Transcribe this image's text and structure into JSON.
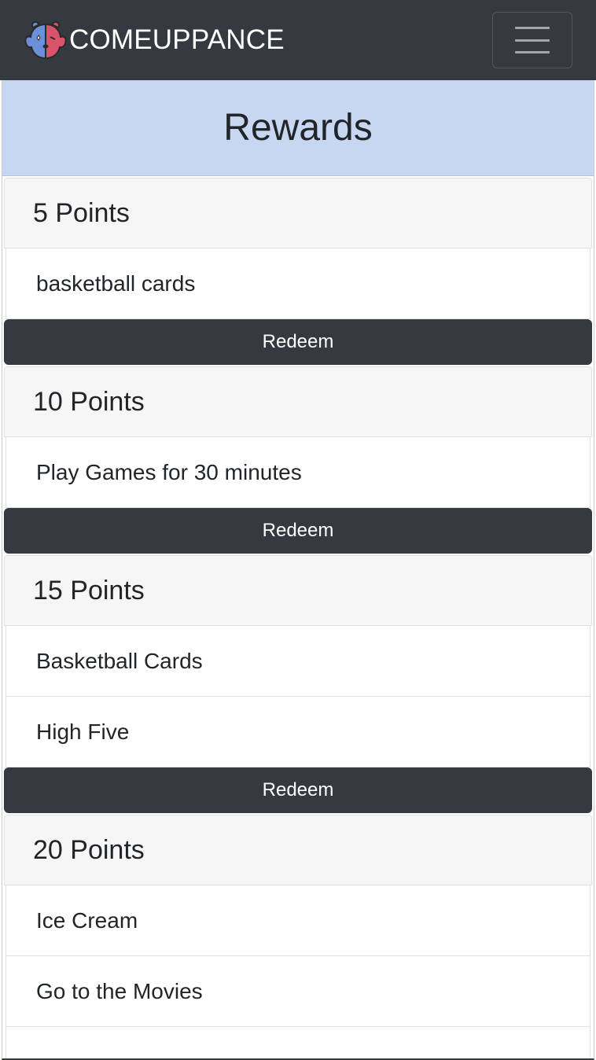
{
  "navbar": {
    "brand": "COMEUPPANCE",
    "logo_icon": "dog-face-logo-icon",
    "menu_icon": "hamburger-menu-icon"
  },
  "page": {
    "title": "Rewards"
  },
  "tiers": [
    {
      "points_label": "5 Points",
      "items": [
        "basketball cards"
      ],
      "redeem_label": "Redeem"
    },
    {
      "points_label": "10 Points",
      "items": [
        "Play Games for 30 minutes"
      ],
      "redeem_label": "Redeem"
    },
    {
      "points_label": "15 Points",
      "items": [
        "Basketball Cards",
        "High Five"
      ],
      "redeem_label": "Redeem"
    },
    {
      "points_label": "20 Points",
      "items": [
        "Ice Cream",
        "Go to the Movies"
      ]
    }
  ],
  "colors": {
    "navbar_bg": "#343a40",
    "title_bar_bg": "#c8d7f1",
    "button_bg": "#343a40",
    "logo_blue": "#6b8fd8",
    "logo_red": "#d9546a"
  }
}
